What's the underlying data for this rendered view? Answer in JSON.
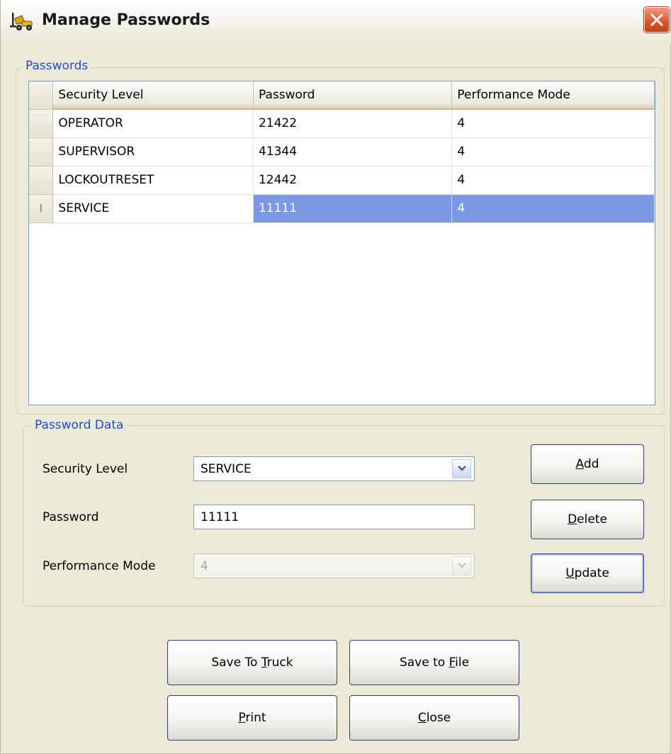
{
  "window": {
    "title": "Manage Passwords",
    "close_icon": "close-x-icon",
    "app_icon": "forklift-icon"
  },
  "passwords_group": {
    "title": "Passwords",
    "columns": [
      "Security Level",
      "Password",
      "Performance Mode"
    ],
    "rows": [
      {
        "security_level": "OPERATOR",
        "password": "21422",
        "performance_mode": "4"
      },
      {
        "security_level": "SUPERVISOR",
        "password": "41344",
        "performance_mode": "4"
      },
      {
        "security_level": "LOCKOUTRESET",
        "password": "12442",
        "performance_mode": "4"
      },
      {
        "security_level": "SERVICE",
        "password": "11111",
        "performance_mode": "4"
      }
    ],
    "selected_row_marker": "I",
    "selection_color": "#7c97e4"
  },
  "password_data_group": {
    "title": "Password Data",
    "security_level_label": "Security Level",
    "security_level_value": "SERVICE",
    "password_label": "Password",
    "password_value": "11111",
    "performance_mode_label": "Performance Mode",
    "performance_mode_value": "4"
  },
  "buttons": {
    "add": {
      "pre": "",
      "key": "A",
      "post": "dd"
    },
    "delete": {
      "pre": "",
      "key": "D",
      "post": "elete"
    },
    "update": {
      "pre": "",
      "key": "U",
      "post": "pdate"
    },
    "save_to_truck": {
      "pre": "Save To ",
      "key": "T",
      "post": "ruck"
    },
    "save_to_file": {
      "pre": "Save to ",
      "key": "F",
      "post": "ile"
    },
    "print": {
      "pre": "",
      "key": "P",
      "post": "rint"
    },
    "close": {
      "pre": "",
      "key": "C",
      "post": "lose"
    }
  }
}
